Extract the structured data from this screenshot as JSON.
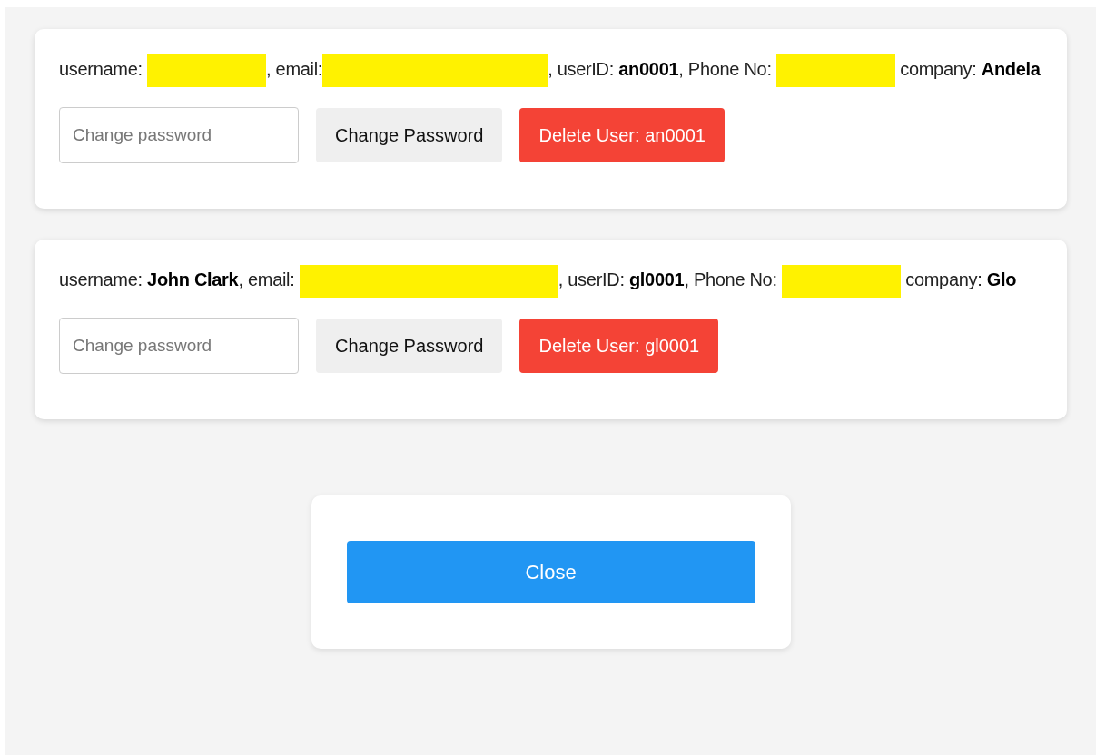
{
  "users": [
    {
      "info": [
        {
          "kind": "text",
          "text": "username: "
        },
        {
          "kind": "redacted_short"
        },
        {
          "kind": "text",
          "text": ", email:"
        },
        {
          "kind": "redacted_long"
        },
        {
          "kind": "text",
          "text": ", userID: "
        },
        {
          "kind": "value",
          "text": "an0001"
        },
        {
          "kind": "text",
          "text": ", Phone No: "
        },
        {
          "kind": "redacted_short"
        },
        {
          "kind": "text",
          "text": " company: "
        },
        {
          "kind": "value",
          "text": "Andela"
        }
      ],
      "password_field": {
        "placeholder": "Change password"
      },
      "change_button": "Change Password",
      "delete_button": "Delete User: an0001"
    },
    {
      "info": [
        {
          "kind": "text",
          "text": "username: "
        },
        {
          "kind": "value",
          "text": "John Clark"
        },
        {
          "kind": "text",
          "text": ", email: "
        },
        {
          "kind": "redacted_wide"
        },
        {
          "kind": "text",
          "text": ", userID: "
        },
        {
          "kind": "value",
          "text": "gl0001"
        },
        {
          "kind": "text",
          "text": ", Phone No: "
        },
        {
          "kind": "redacted_short"
        },
        {
          "kind": "text",
          "text": " company: "
        },
        {
          "kind": "value",
          "text": "Glo"
        }
      ],
      "password_field": {
        "placeholder": "Change password"
      },
      "change_button": "Change Password",
      "delete_button": "Delete User: gl0001"
    }
  ],
  "close_button": "Close"
}
